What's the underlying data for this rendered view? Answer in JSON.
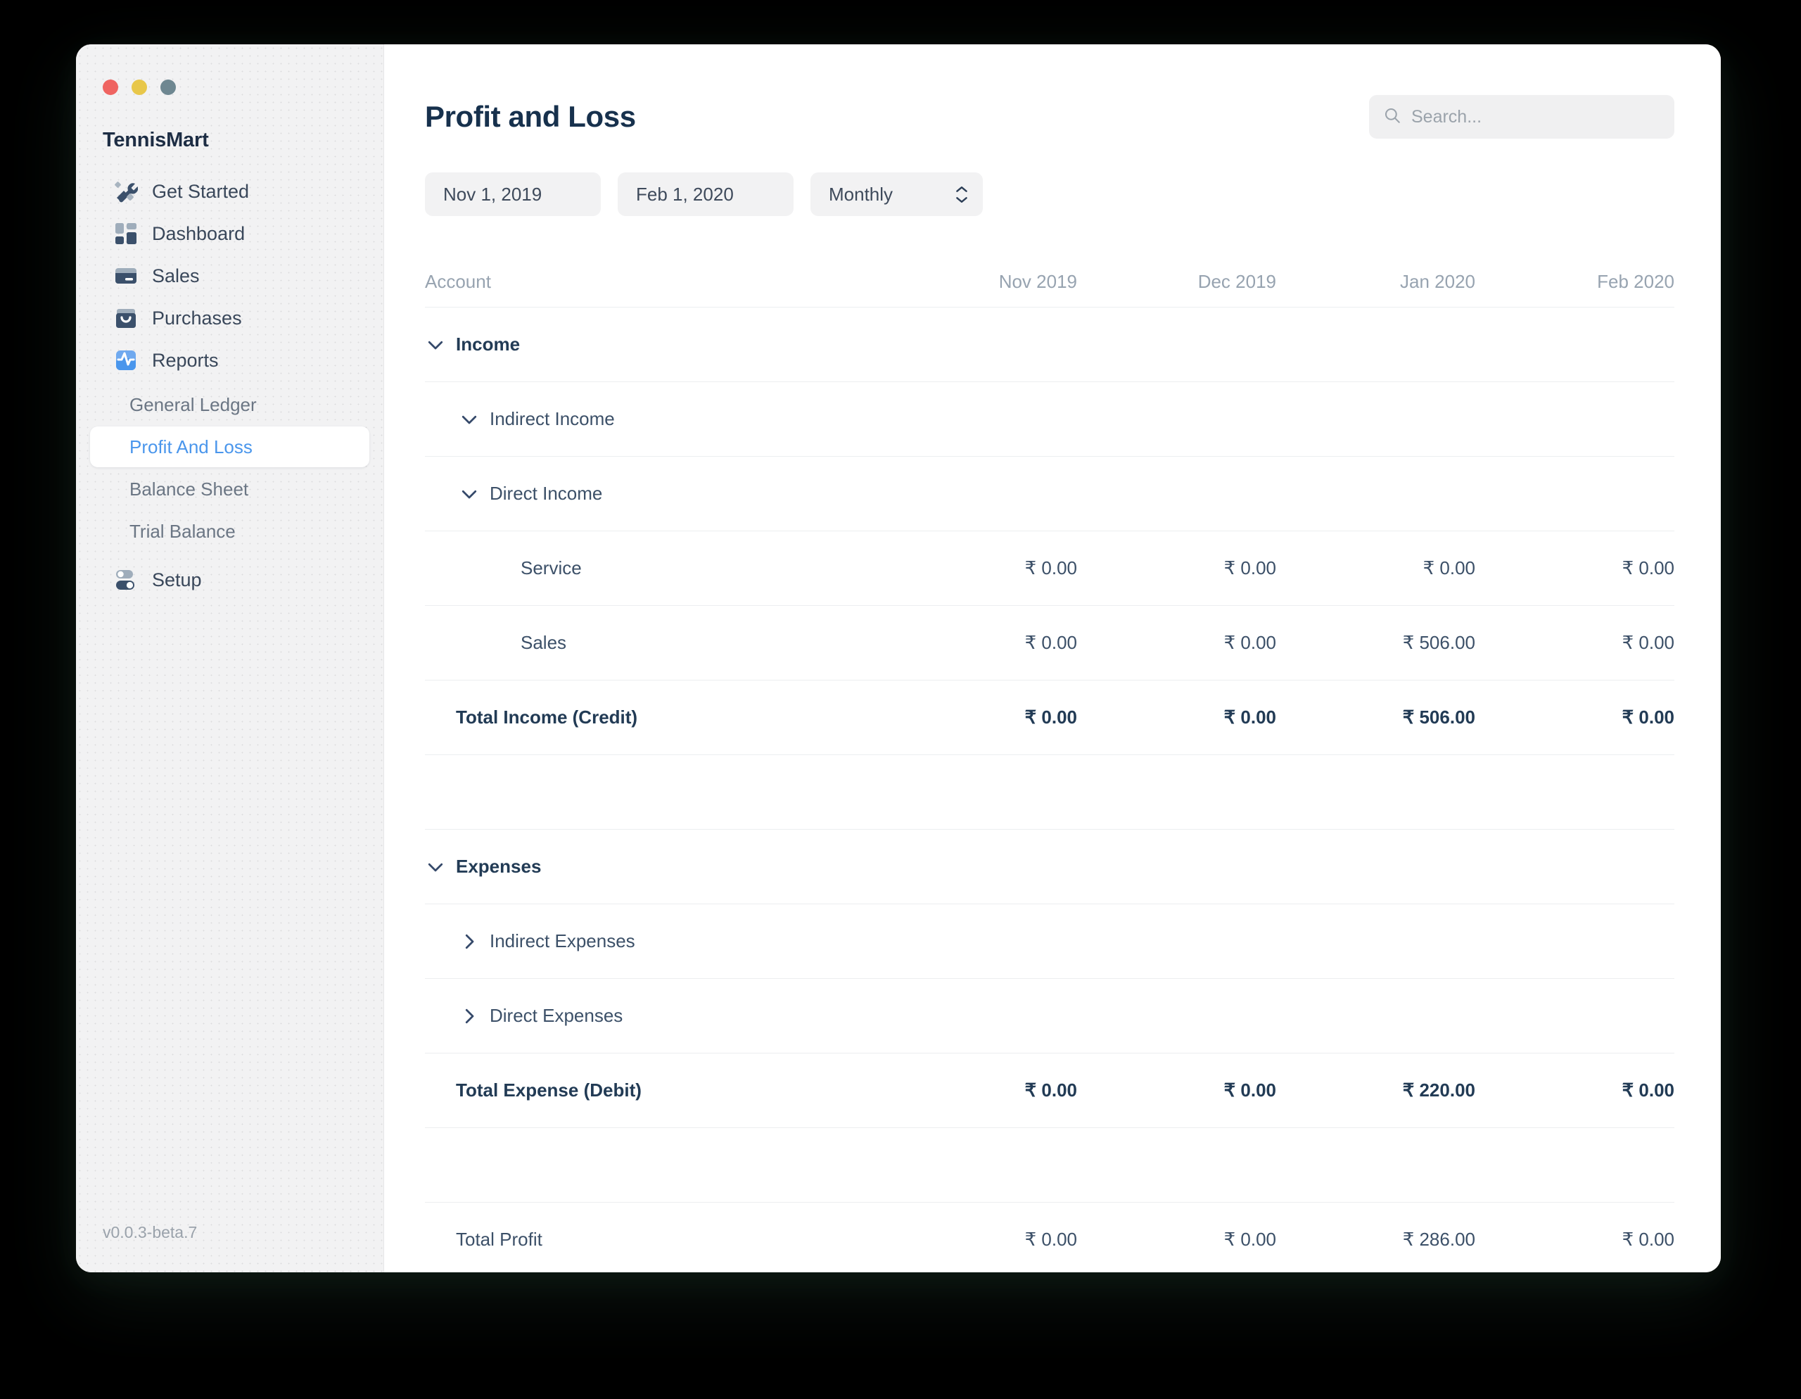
{
  "window": {
    "traffic_lights": [
      {
        "name": "close",
        "color": "#ef6461"
      },
      {
        "name": "minimize",
        "color": "#e8c74a"
      },
      {
        "name": "maximize",
        "color": "#6e8791"
      }
    ]
  },
  "sidebar": {
    "brand": "TennisMart",
    "version": "v0.0.3-beta.7",
    "items": [
      {
        "label": "Get Started",
        "icon": "tools-icon"
      },
      {
        "label": "Dashboard",
        "icon": "dashboard-icon"
      },
      {
        "label": "Sales",
        "icon": "card-icon"
      },
      {
        "label": "Purchases",
        "icon": "basket-icon"
      },
      {
        "label": "Reports",
        "icon": "activity-icon"
      }
    ],
    "reports_children": [
      {
        "label": "General Ledger",
        "active": false
      },
      {
        "label": "Profit And Loss",
        "active": true
      },
      {
        "label": "Balance Sheet",
        "active": false
      },
      {
        "label": "Trial Balance",
        "active": false
      }
    ],
    "setup": {
      "label": "Setup",
      "icon": "toggles-icon"
    },
    "active_color": "#4a96ec"
  },
  "header": {
    "title": "Profit and Loss"
  },
  "search": {
    "placeholder": "Search...",
    "value": "",
    "icon": "search-icon"
  },
  "filters": {
    "from_date": "Nov 1, 2019",
    "to_date": "Feb 1, 2020",
    "periodicity": "Monthly",
    "periodicity_options": [
      "Monthly"
    ]
  },
  "table": {
    "columns": [
      "Account",
      "Nov 2019",
      "Dec 2019",
      "Jan 2020",
      "Feb 2020"
    ],
    "rows": [
      {
        "label": "Income",
        "indent": 0,
        "bold": true,
        "chevron": "down",
        "values": [
          "",
          "",
          "",
          ""
        ],
        "height": "row-h"
      },
      {
        "label": "Indirect Income",
        "indent": 1,
        "bold": false,
        "chevron": "down",
        "values": [
          "",
          "",
          "",
          ""
        ],
        "height": "row-tall"
      },
      {
        "label": "Direct Income",
        "indent": 1,
        "bold": false,
        "chevron": "down",
        "values": [
          "",
          "",
          "",
          ""
        ],
        "height": "row-tall"
      },
      {
        "label": "Service",
        "indent": 2,
        "bold": false,
        "chevron": "none",
        "values": [
          "₹ 0.00",
          "₹ 0.00",
          "₹ 0.00",
          "₹ 0.00"
        ],
        "height": "row-tall"
      },
      {
        "label": "Sales",
        "indent": 2,
        "bold": false,
        "chevron": "none",
        "values": [
          "₹ 0.00",
          "₹ 0.00",
          "₹ 506.00",
          "₹ 0.00"
        ],
        "height": "row-tall"
      },
      {
        "label": "Total Income (Credit)",
        "indent": 0,
        "bold": true,
        "chevron": "none",
        "values": [
          "₹ 0.00",
          "₹ 0.00",
          "₹ 506.00",
          "₹ 0.00"
        ],
        "height": "row-tall"
      },
      {
        "label": "",
        "indent": 0,
        "bold": false,
        "chevron": "none",
        "values": [
          "",
          "",
          "",
          ""
        ],
        "height": "row-spacer"
      },
      {
        "label": "Expenses",
        "indent": 0,
        "bold": true,
        "chevron": "down",
        "values": [
          "",
          "",
          "",
          ""
        ],
        "height": "row-h"
      },
      {
        "label": "Indirect Expenses",
        "indent": 1,
        "bold": false,
        "chevron": "right",
        "values": [
          "",
          "",
          "",
          ""
        ],
        "height": "row-tall"
      },
      {
        "label": "Direct Expenses",
        "indent": 1,
        "bold": false,
        "chevron": "right",
        "values": [
          "",
          "",
          "",
          ""
        ],
        "height": "row-tall"
      },
      {
        "label": "Total Expense (Debit)",
        "indent": 0,
        "bold": true,
        "chevron": "none",
        "values": [
          "₹ 0.00",
          "₹ 0.00",
          "₹ 220.00",
          "₹ 0.00"
        ],
        "height": "row-tall"
      },
      {
        "label": "",
        "indent": 0,
        "bold": false,
        "chevron": "none",
        "values": [
          "",
          "",
          "",
          ""
        ],
        "height": "row-spacer"
      },
      {
        "label": "Total Profit",
        "indent": 0,
        "bold": false,
        "chevron": "none",
        "values": [
          "₹ 0.00",
          "₹ 0.00",
          "₹ 286.00",
          "₹ 0.00"
        ],
        "height": "row-tall"
      }
    ]
  }
}
